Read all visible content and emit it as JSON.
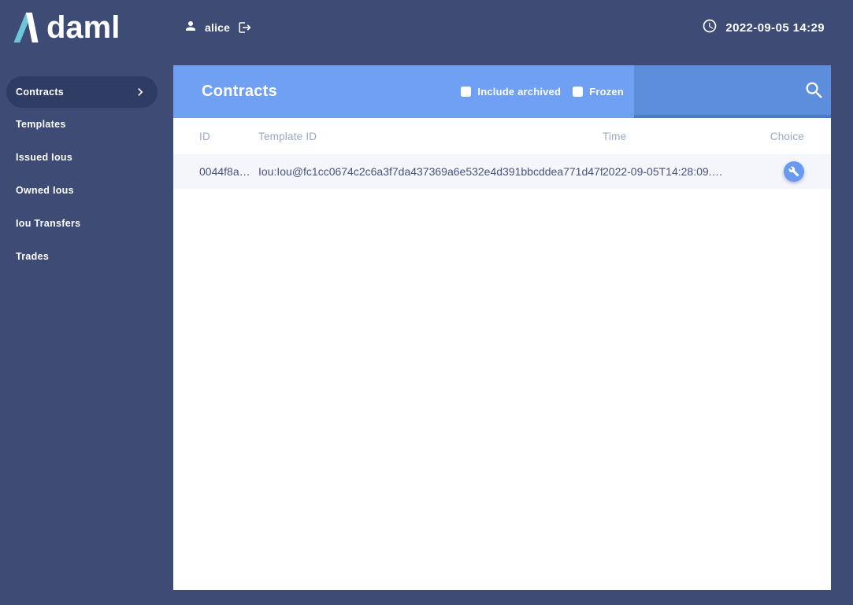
{
  "app": {
    "logo_text": "daml",
    "user": {
      "name": "alice"
    },
    "clock": {
      "text": "2022-09-05 14:29"
    }
  },
  "sidebar": {
    "items": [
      {
        "label": "Contracts",
        "active": true
      },
      {
        "label": "Templates",
        "active": false
      },
      {
        "label": "Issued Ious",
        "active": false
      },
      {
        "label": "Owned Ious",
        "active": false
      },
      {
        "label": "Iou Transfers",
        "active": false
      },
      {
        "label": "Trades",
        "active": false
      }
    ]
  },
  "main": {
    "title": "Contracts",
    "filters": [
      {
        "label": "Include archived",
        "checked": false
      },
      {
        "label": "Frozen",
        "checked": false
      }
    ],
    "search": {
      "value": "",
      "placeholder": ""
    },
    "table": {
      "columns": [
        "ID",
        "Template ID",
        "Time",
        "Choice"
      ],
      "rows": [
        {
          "id": "0044f8a…",
          "template_id": "Iou:Iou@fc1cc0674c2c6a3f7da437369a6e532e4d391bbcddea771d47f…",
          "time": "2022-09-05T14:28:09.…",
          "choice_icon": "wrench-icon"
        }
      ]
    }
  },
  "icons": {
    "logo": "lambda-logo",
    "user": "person-icon",
    "logout": "logout-icon",
    "clock": "clock-icon",
    "active_item": "chevron-right-icon",
    "search": "search-icon",
    "choice": "wrench-icon"
  },
  "colors": {
    "background_navy": "#3d4b75",
    "sidebar_active_pill": "#2e3c63",
    "toolbar_blue": "#6fa0f3",
    "search_blue": "#5c8edb",
    "search_border": "#4a7ac9",
    "row_bg": "#f4f6fc",
    "header_text": "#9aa8c6",
    "row_text": "#475379",
    "logo_teal": "#6ec6d9",
    "choice_button_blue": "#699af0"
  }
}
